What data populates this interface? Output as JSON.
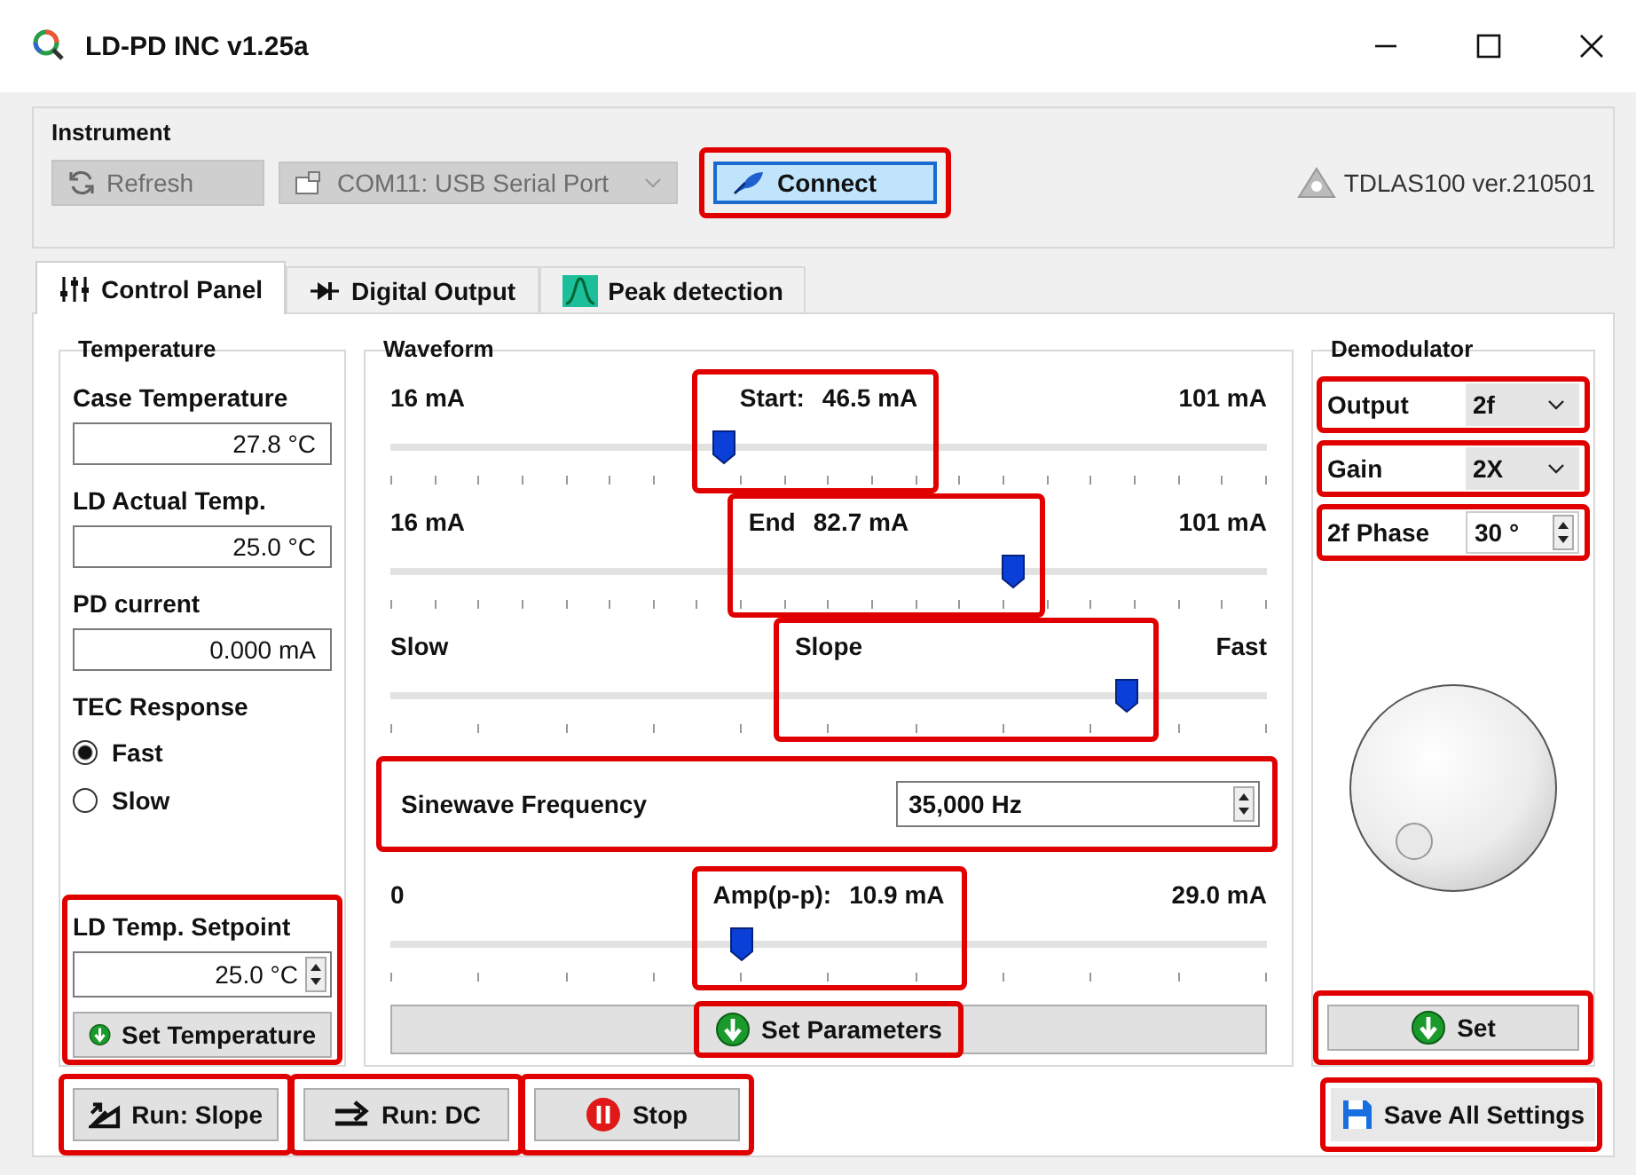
{
  "window": {
    "title": "LD-PD INC v1.25a"
  },
  "instrument": {
    "title": "Instrument",
    "refresh": {
      "label": "Refresh",
      "disabled": true
    },
    "port": {
      "value": "COM11: USB Serial Port",
      "disabled": true
    },
    "connect": {
      "label": "Connect",
      "selected": true,
      "highlighted": true
    },
    "version": "TDLAS100 ver.210501"
  },
  "tabs": [
    {
      "label": "Control Panel",
      "kind": "sliders",
      "selected": true
    },
    {
      "label": "Digital Output",
      "kind": "diode",
      "selected": false
    },
    {
      "label": "Peak detection",
      "kind": "peak",
      "selected": false
    }
  ],
  "temperature": {
    "title": "Temperature",
    "readouts": [
      {
        "label": "Case Temperature",
        "value": "27.8 °C"
      },
      {
        "label": "LD Actual Temp.",
        "value": "25.0 °C"
      },
      {
        "label": "PD current",
        "value": "0.000 mA"
      }
    ],
    "tec_response": {
      "label": "TEC Response",
      "options": [
        {
          "label": "Fast",
          "selected": true
        },
        {
          "label": "Slow",
          "selected": false
        }
      ]
    },
    "setpoint": {
      "label": "LD Temp. Setpoint",
      "value": "25.0 °C",
      "button": "Set Temperature",
      "highlighted": true
    }
  },
  "waveform": {
    "title": "Waveform",
    "controls": [
      {
        "kind": "fine-slider",
        "min_label": "16 mA",
        "center_label": "Start:",
        "reading": "46.5 mA",
        "max_label": "101 mA",
        "level": 0.38,
        "highlighted": true
      },
      {
        "kind": "fine-slider",
        "min_label": "16 mA",
        "center_label": "End",
        "reading": "82.7 mA",
        "max_label": "101 mA",
        "level": 0.71,
        "highlighted": true
      },
      {
        "kind": "coarse-slider",
        "min_label": "Slow",
        "center_label": "Slope",
        "max_label": "Fast",
        "level": 0.84,
        "highlighted": true
      },
      {
        "kind": "spinner",
        "label": "Sinewave Frequency",
        "value": "35,000 Hz",
        "highlighted": true
      },
      {
        "kind": "coarse-slider",
        "min_label": "0",
        "center_label": "Amp(p-p):",
        "reading": "10.9 mA",
        "max_label": "29.0 mA",
        "level": 0.4,
        "highlighted": true
      }
    ],
    "button": {
      "label": "Set Parameters",
      "highlighted": true
    }
  },
  "demodulator": {
    "title": "Demodulator",
    "fields": [
      {
        "kind": "select",
        "label": "Output",
        "value": "2f",
        "highlighted": true
      },
      {
        "kind": "select",
        "label": "Gain",
        "value": "2X",
        "highlighted": true
      },
      {
        "kind": "spinner",
        "label": "2f Phase",
        "value": "30 °",
        "highlighted": true
      }
    ],
    "button": {
      "label": "Set",
      "highlighted": true
    }
  },
  "actions": [
    {
      "kind": "slope",
      "label": "Run: Slope",
      "highlighted": true
    },
    {
      "kind": "dc",
      "label": "Run: DC",
      "highlighted": true
    },
    {
      "kind": "stop",
      "label": "Stop",
      "highlighted": true
    }
  ],
  "save": {
    "label": "Save All Settings",
    "highlighted": true
  }
}
